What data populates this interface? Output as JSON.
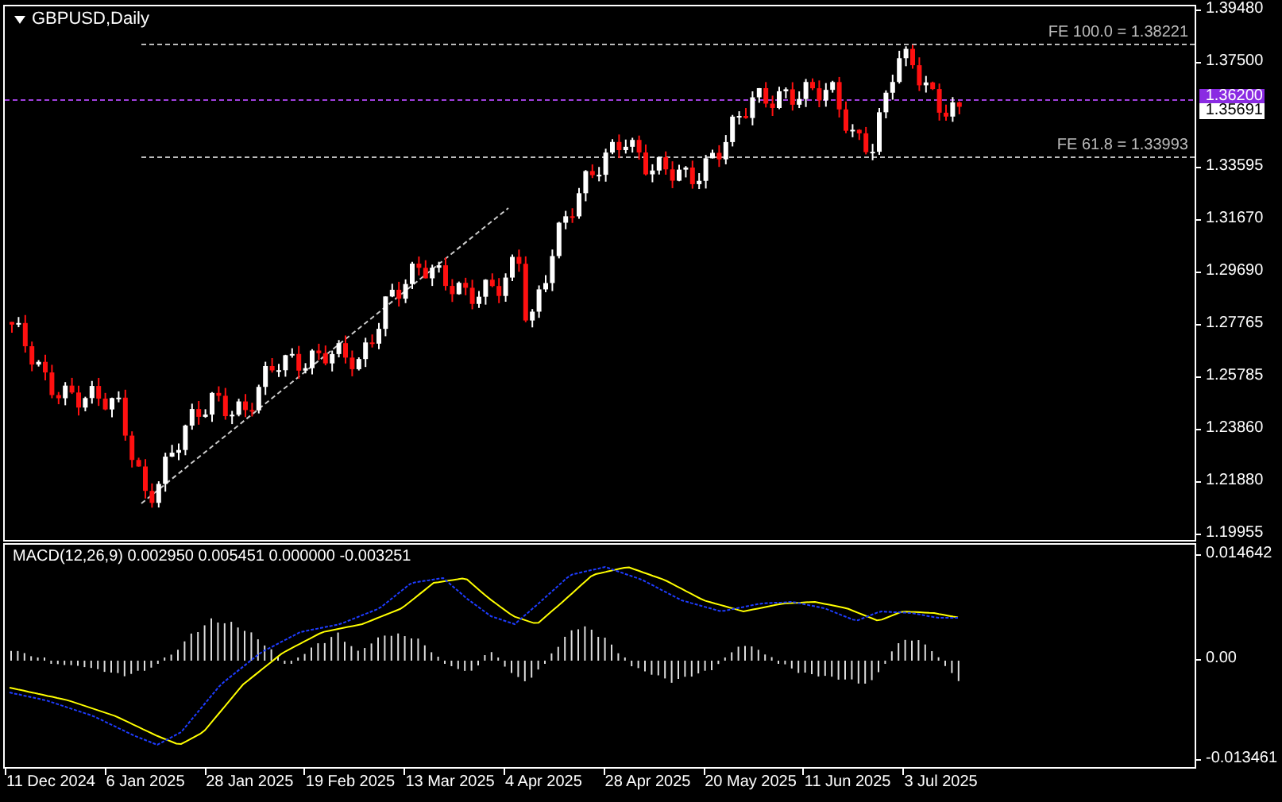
{
  "chart": {
    "title": "GBPUSD,Daily",
    "fibo_levels": [
      {
        "label": "FE 100.0 = 1.38221"
      },
      {
        "label": "FE 61.8 = 1.33993"
      }
    ],
    "price_ticks": [
      "1.39480",
      "1.37500",
      "1.33595",
      "1.31670",
      "1.29690",
      "1.27765",
      "1.25785",
      "1.23860",
      "1.21880",
      "1.19955"
    ],
    "price_tags": [
      {
        "label": "1.36200",
        "kind": "alert"
      },
      {
        "label": "1.35691",
        "kind": "bid"
      }
    ]
  },
  "macd": {
    "label": "MACD(12,26,9) 0.002950 0.005451 0.000000 -0.003251",
    "scale": [
      "0.014642",
      "0.00",
      "-0.013461"
    ]
  },
  "time_axis": [
    "11 Dec 2024",
    "6 Jan 2025",
    "28 Jan 2025",
    "19 Feb 2025",
    "13 Mar 2025",
    "4 Apr 2025",
    "28 Apr 2025",
    "20 May 2025",
    "11 Jun 2025",
    "3 Jul 2025"
  ]
}
